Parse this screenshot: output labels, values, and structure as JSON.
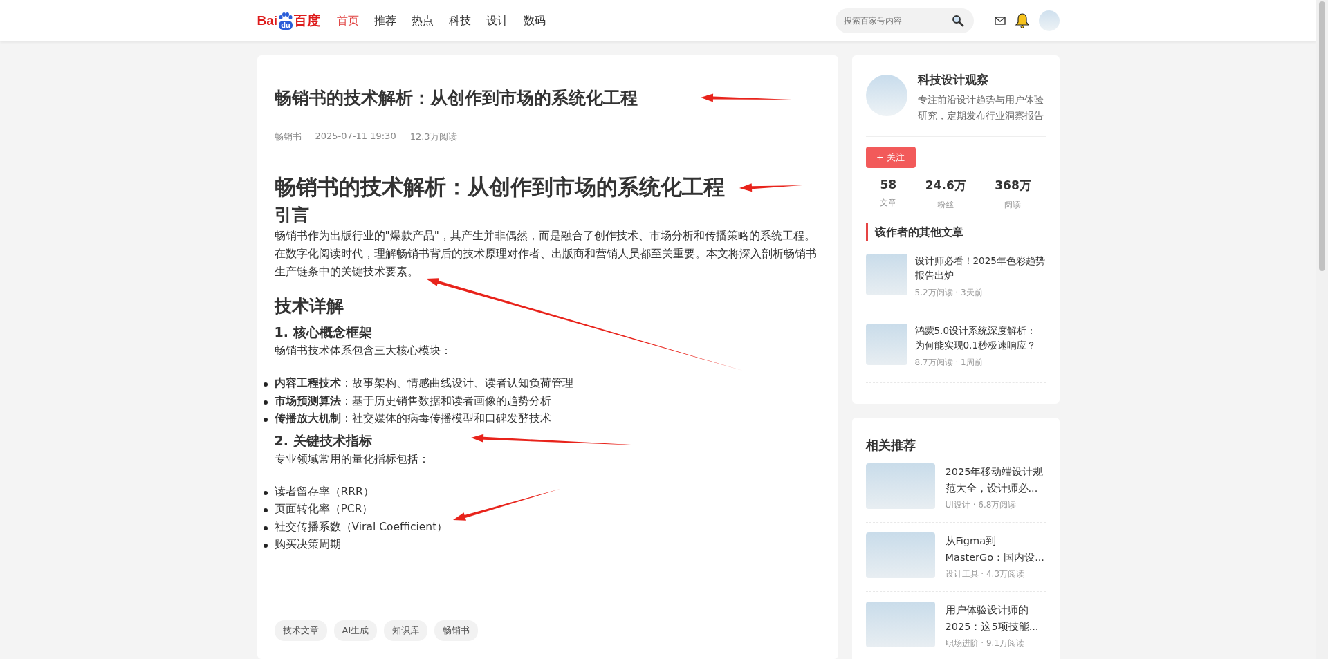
{
  "header": {
    "logo": {
      "left": "Bai",
      "badge": "du",
      "right": "百度"
    },
    "nav": [
      {
        "label": "首页",
        "selected": true
      },
      {
        "label": "推荐",
        "selected": false
      },
      {
        "label": "热点",
        "selected": false
      },
      {
        "label": "科技",
        "selected": false
      },
      {
        "label": "设计",
        "selected": false
      },
      {
        "label": "数码",
        "selected": false
      }
    ],
    "search": {
      "placeholder": "搜索百家号内容"
    }
  },
  "article": {
    "title": "畅销书的技术解析：从创作到市场的系统化工程",
    "meta": [
      "畅销书",
      "2025-07-11 19:30",
      "12.3万阅读"
    ],
    "content": [
      {
        "kind": "h1",
        "text": "畅销书的技术解析：从创作到市场的系统化工程"
      },
      {
        "kind": "h2",
        "text": "引言"
      },
      {
        "kind": "p",
        "text": "畅销书作为出版行业的\"爆款产品\"，其产生并非偶然，而是融合了创作技术、市场分析和传播策略的系统工程。在数字化阅读时代，理解畅销书背后的技术原理对作者、出版商和营销人员都至关重要。本文将深入剖析畅销书生产链条中的关键技术要素。"
      },
      {
        "kind": "h2",
        "text": "技术详解"
      },
      {
        "kind": "h3",
        "text": "1. 核心概念框架"
      },
      {
        "kind": "p",
        "text": "畅销书技术体系包含三大核心模块："
      },
      {
        "kind": "ul",
        "items": [
          "**内容工程技术**：故事架构、情感曲线设计、读者认知负荷管理",
          "**市场预测算法**：基于历史销售数据和读者画像的趋势分析",
          "**传播放大机制**：社交媒体的病毒传播模型和口碑发酵技术"
        ]
      },
      {
        "kind": "h3",
        "text": "2. 关键技术指标"
      },
      {
        "kind": "p",
        "text": "专业领域常用的量化指标包括："
      },
      {
        "kind": "ul",
        "items": [
          "读者留存率（RRR）",
          "页面转化率（PCR）",
          "社交传播系数（Viral Coefficient）",
          "购买决策周期"
        ]
      }
    ],
    "tags": [
      "技术文章",
      "AI生成",
      "知识库",
      "畅销书"
    ]
  },
  "author": {
    "name": "科技设计观察",
    "bio": "专注前沿设计趋势与用户体验研究，定期发布行业洞察报告",
    "follow": "+ 关注",
    "stats": [
      {
        "value": "58",
        "label": "文章"
      },
      {
        "value": "24.6万",
        "label": "粉丝"
      },
      {
        "value": "368万",
        "label": "阅读"
      }
    ],
    "other_title": "该作者的其他文章",
    "other_articles": [
      {
        "title": "设计师必看！2025年色彩趋势报告出炉",
        "meta": "5.2万阅读 · 3天前"
      },
      {
        "title": "鸿蒙5.0设计系统深度解析：为何能实现0.1秒极速响应？",
        "meta": "8.7万阅读 · 1周前"
      }
    ]
  },
  "related": {
    "title": "相关推荐",
    "items": [
      {
        "title": "2025年移动端设计规范大全，设计师必...",
        "meta": "UI设计 · 6.8万阅读"
      },
      {
        "title": "从Figma到MasterGo：国内设...",
        "meta": "设计工具 · 4.3万阅读"
      },
      {
        "title": "用户体验设计师的2025：这5项技能...",
        "meta": "职场进阶 · 9.1万阅读"
      }
    ]
  }
}
